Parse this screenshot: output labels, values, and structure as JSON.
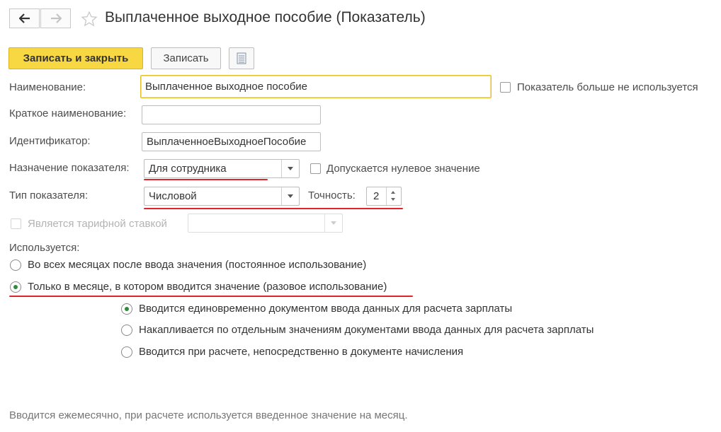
{
  "header": {
    "title": "Выплаченное выходное пособие (Показатель)"
  },
  "toolbar": {
    "save_close_label": "Записать и закрыть",
    "save_label": "Записать",
    "colors": {
      "primary": "#f7d742"
    }
  },
  "form": {
    "name_label": "Наименование:",
    "name_value": "Выплаченное выходное пособие",
    "unused_label": "Показатель больше не используется",
    "short_name_label": "Краткое наименование:",
    "short_name_value": "",
    "identifier_label": "Идентификатор:",
    "identifier_value": "ВыплаченноеВыходноеПособие",
    "purpose_label": "Назначение показателя:",
    "purpose_value": "Для сотрудника",
    "zero_allowed_label": "Допускается нулевое значение",
    "type_label": "Тип показателя:",
    "type_value": "Числовой",
    "precision_label": "Точность:",
    "precision_value": "2",
    "tariff_label": "Является тарифной ставкой",
    "tariff_value": ""
  },
  "usage": {
    "label": "Используется:",
    "options": [
      "Во всех месяцах после ввода значения (постоянное использование)",
      "Только в месяце, в котором вводится значение (разовое использование)"
    ],
    "selected": 1,
    "sub_options": [
      "Вводится единовременно документом ввода данных для расчета зарплаты",
      "Накапливается по отдельным значениям документами ввода данных для расчета зарплаты",
      "Вводится при расчете, непосредственно в документе начисления"
    ],
    "sub_selected": 0
  },
  "footer": {
    "note": "Вводится ежемесячно, при расчете используется введенное значение на месяц."
  }
}
